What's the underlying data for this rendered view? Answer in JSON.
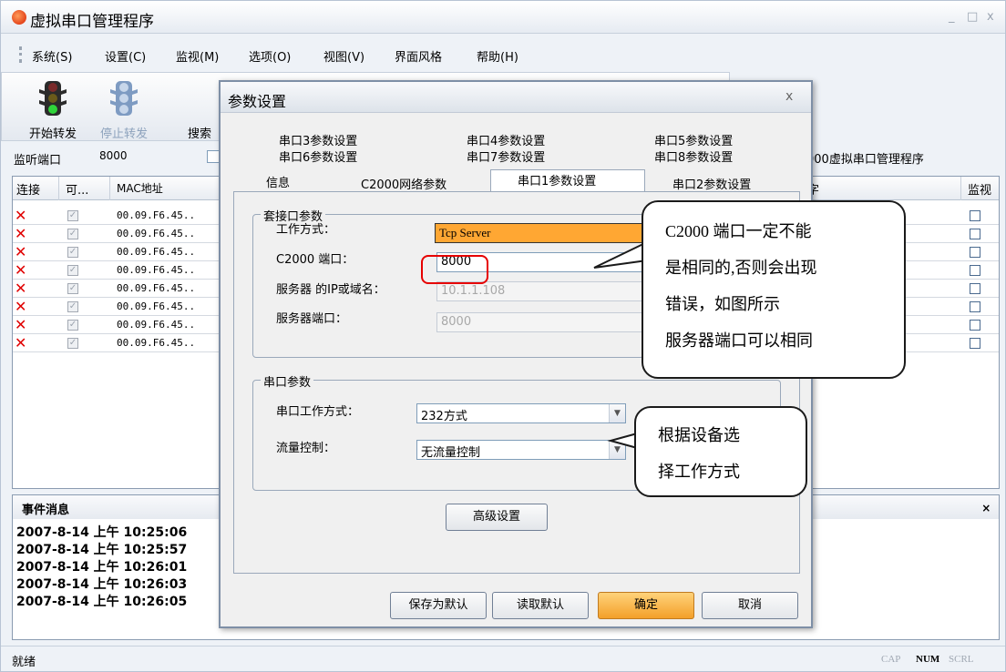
{
  "app": {
    "title": "虚拟串口管理程序",
    "window_controls": {
      "minimize": "_",
      "maximize": "□",
      "close": "x"
    }
  },
  "menu": [
    "系统(S)",
    "设置(C)",
    "监视(M)",
    "选项(O)",
    "视图(V)",
    "界面风格",
    "帮助(H)"
  ],
  "toolbar": {
    "start_label": "开始转发",
    "stop_label": "停止转发",
    "search_label": "搜索"
  },
  "listen": {
    "label": "监听端口",
    "value": "8000"
  },
  "right_title": "000虚拟串口管理程序",
  "table": {
    "headers": [
      "连接",
      "可...",
      "MAC地址",
      "字",
      "监视"
    ],
    "rows": [
      {
        "mac": "00.09.F6.45.."
      },
      {
        "mac": "00.09.F6.45.."
      },
      {
        "mac": "00.09.F6.45.."
      },
      {
        "mac": "00.09.F6.45.."
      },
      {
        "mac": "00.09.F6.45.."
      },
      {
        "mac": "00.09.F6.45.."
      },
      {
        "mac": "00.09.F6.45.."
      },
      {
        "mac": "00.09.F6.45.."
      }
    ]
  },
  "events": {
    "title": "事件消息",
    "pin": "ᅟ ×",
    "lines": [
      "2007-8-14 上午 10:25:06",
      "2007-8-14 上午 10:25:57",
      "2007-8-14 上午 10:26:01",
      "2007-8-14 上午 10:26:03",
      "2007-8-14 上午 10:26:05"
    ]
  },
  "status": {
    "text": "就绪",
    "cap": "CAP",
    "num": "NUM",
    "scrl": "SCRL"
  },
  "dialog": {
    "title": "参数设置",
    "close": "x",
    "tabs_row1": [
      "串口3参数设置",
      "串口4参数设置",
      "串口5参数设置"
    ],
    "tabs_row2": [
      "串口6参数设置",
      "串口7参数设置",
      "串口8参数设置"
    ],
    "tabs_row3": [
      "信息",
      "C2000网络参数",
      "串口1参数设置",
      "串口2参数设置"
    ],
    "socket_group": {
      "title": "套接口参数",
      "work_mode_label": "工作方式：",
      "work_mode_value": "Tcp Server",
      "port_label": "C2000 端口：",
      "port_value": "8000",
      "server_ip_label": "服务器 的IP或域名：",
      "server_ip_value": "10.1.1.108",
      "server_port_label": "服务器端口：",
      "server_port_value": "8000"
    },
    "serial_group": {
      "title": "串口参数",
      "mode_label": "串口工作方式：",
      "mode_value": "232方式",
      "flow_label": "流量控制：",
      "flow_value": "无流量控制"
    },
    "advanced_button": "高级设置",
    "buttons": {
      "save_default": "保存为默认",
      "load_default": "读取默认",
      "ok": "确定",
      "cancel": "取消"
    }
  },
  "callouts": {
    "port_note": [
      "C2000 端口一定不能",
      "是相同的,否则会出现",
      "错误，如图所示",
      "服务器端口可以相同"
    ],
    "mode_note": [
      "根据设备选",
      "择工作方式"
    ]
  },
  "colors": {
    "error_x": "#e00000",
    "highlight_ring": "#e60000",
    "ok_button": "#f3a02a"
  }
}
